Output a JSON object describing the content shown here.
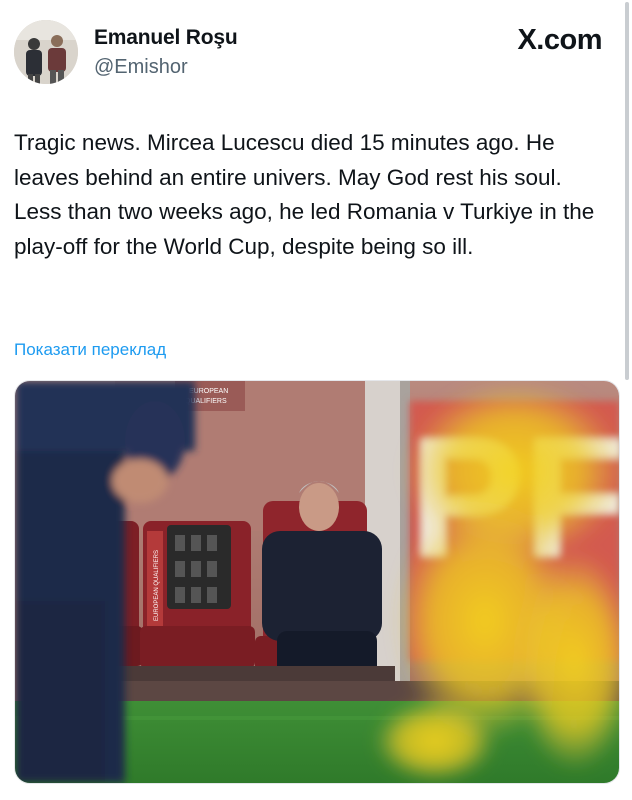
{
  "author": {
    "name": "Emanuel Roşu",
    "handle": "@Emishor"
  },
  "brand": "X.com",
  "tweet": {
    "text": "Tragic news. Mircea Lucescu died 15 minutes ago. He leaves behind an entire univers. May God rest his soul. Less than two weeks ago, he led Romania v Turkiye in the play-off for the World Cup, despite being so ill."
  },
  "translate_label": "Показати переклад",
  "media": {
    "banner_text": [
      "EUROPEAN",
      "QUALIFIERS"
    ],
    "seat_badge": "EUROPEAN QUALIFIERS",
    "board_letters": "PF"
  }
}
